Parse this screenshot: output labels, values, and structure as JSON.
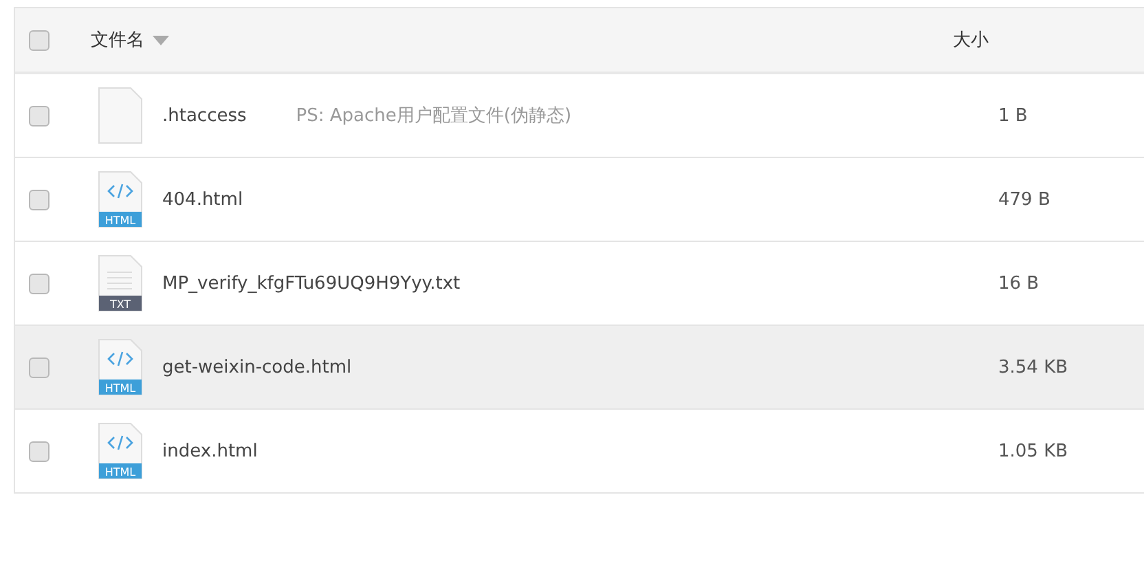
{
  "header": {
    "checked": false,
    "name_label": "文件名",
    "size_label": "大小"
  },
  "files": [
    {
      "name": ".htaccess",
      "note": "PS: Apache用户配置文件(伪静态)",
      "size": "1 B",
      "kind": "blank",
      "checked": false,
      "highlighted": false
    },
    {
      "name": "404.html",
      "size": "479 B",
      "kind": "html",
      "icon_label": "HTML",
      "checked": false,
      "highlighted": false
    },
    {
      "name": "MP_verify_kfgFTu69UQ9H9Yyy.txt",
      "size": "16 B",
      "kind": "txt",
      "icon_label": "TXT",
      "checked": false,
      "highlighted": false
    },
    {
      "name": "get-weixin-code.html",
      "size": "3.54 KB",
      "kind": "html",
      "icon_label": "HTML",
      "checked": false,
      "highlighted": true
    },
    {
      "name": "index.html",
      "size": "1.05 KB",
      "kind": "html",
      "icon_label": "HTML",
      "checked": false,
      "highlighted": false
    }
  ]
}
